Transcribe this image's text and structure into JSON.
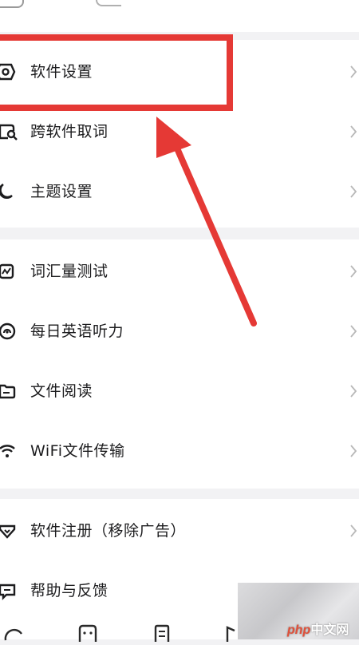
{
  "settings": {
    "group1": [
      {
        "label": "软件设置",
        "icon": "hexagon-settings-icon"
      },
      {
        "label": "跨软件取词",
        "icon": "square-search-icon"
      },
      {
        "label": "主题设置",
        "icon": "moon-icon"
      }
    ],
    "group2": [
      {
        "label": "词汇量测试",
        "icon": "chart-square-icon"
      },
      {
        "label": "每日英语听力",
        "icon": "headphone-circle-icon"
      },
      {
        "label": "文件阅读",
        "icon": "folder-icon"
      },
      {
        "label": "WiFi文件传输",
        "icon": "wifi-icon"
      }
    ],
    "group3": [
      {
        "label": "软件注册（移除广告）",
        "icon": "shield-heart-icon"
      },
      {
        "label": "帮助与反馈",
        "icon": "chat-bubble-icon"
      }
    ]
  },
  "watermark": {
    "brand": "php",
    "suffix": "中文网"
  },
  "colors": {
    "highlight": "#e53935",
    "chevron": "#b8b8b8",
    "text": "#1c1c1e"
  }
}
